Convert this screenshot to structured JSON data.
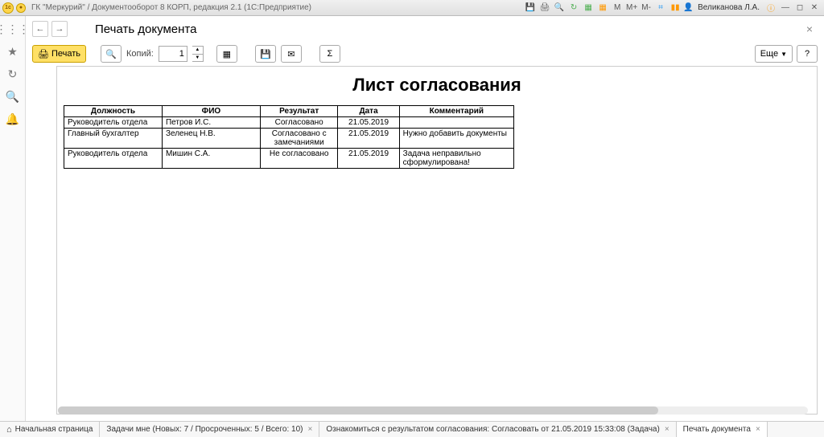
{
  "titlebar": {
    "app": "ГК \"Меркурий\" / Документооборот 8 КОРП, редакция 2.1  (1С:Предприятие)",
    "user": "Великанова Л.А."
  },
  "page": {
    "title": "Печать документа"
  },
  "toolbar": {
    "print": "Печать",
    "copies_label": "Копий:",
    "copies_value": "1",
    "more": "Еще",
    "help": "?"
  },
  "document": {
    "title": "Лист согласования",
    "columns": [
      "Должность",
      "ФИО",
      "Результат",
      "Дата",
      "Комментарий"
    ],
    "rows": [
      {
        "position": "Руководитель отдела",
        "fio": "Петров И.С.",
        "result": "Согласовано",
        "date": "21.05.2019",
        "comment": ""
      },
      {
        "position": "Главный бухгалтер",
        "fio": "Зеленец Н.В.",
        "result": "Согласовано с замечаниями",
        "date": "21.05.2019",
        "comment": "Нужно добавить документы"
      },
      {
        "position": "Руководитель отдела",
        "fio": "Мишин С.А.",
        "result": "Не согласовано",
        "date": "21.05.2019",
        "comment": "Задача неправильно сформулирована!"
      }
    ]
  },
  "tabs": {
    "home": "Начальная страница",
    "t1": "Задачи мне (Новых: 7 / Просроченных: 5 / Всего: 10)",
    "t2": "Ознакомиться с результатом согласования: Согласовать от 21.05.2019 15:33:08 (Задача)",
    "t3": "Печать документа"
  }
}
